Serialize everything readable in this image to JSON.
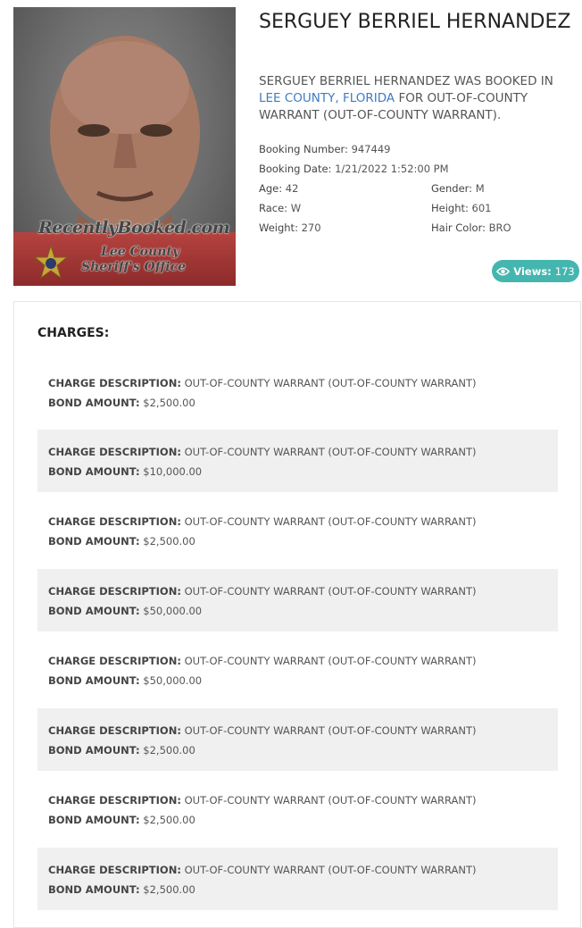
{
  "person": {
    "name": "SERGUEY BERRIEL HERNANDEZ",
    "summary_prefix": "SERGUEY BERRIEL HERNANDEZ WAS BOOKED IN",
    "location_link": "LEE COUNTY, FLORIDA",
    "summary_suffix": "FOR OUT-OF-COUNTY WARRANT (OUT-OF-COUNTY WARRANT)."
  },
  "photo": {
    "watermark_site": "RecentlyBooked.com",
    "watermark_county": "Lee County",
    "watermark_office": "Sheriff's Office"
  },
  "details": {
    "booking_number_label": "Booking Number:",
    "booking_number": "947449",
    "booking_date_label": "Booking Date:",
    "booking_date": "1/21/2022 1:52:00 PM",
    "age_label": "Age:",
    "age": "42",
    "gender_label": "Gender:",
    "gender": "M",
    "race_label": "Race:",
    "race": "W",
    "height_label": "Height:",
    "height": "601",
    "weight_label": "Weight:",
    "weight": "270",
    "hair_label": "Hair Color:",
    "hair": "BRO"
  },
  "views": {
    "label": "Views:",
    "count": "173"
  },
  "charges": {
    "heading": "CHARGES:",
    "desc_label": "CHARGE DESCRIPTION:",
    "bond_label": "BOND AMOUNT:",
    "items": [
      {
        "description": "OUT-OF-COUNTY WARRANT (OUT-OF-COUNTY WARRANT)",
        "bond": "$2,500.00"
      },
      {
        "description": "OUT-OF-COUNTY WARRANT (OUT-OF-COUNTY WARRANT)",
        "bond": "$10,000.00"
      },
      {
        "description": "OUT-OF-COUNTY WARRANT (OUT-OF-COUNTY WARRANT)",
        "bond": "$2,500.00"
      },
      {
        "description": "OUT-OF-COUNTY WARRANT (OUT-OF-COUNTY WARRANT)",
        "bond": "$50,000.00"
      },
      {
        "description": "OUT-OF-COUNTY WARRANT (OUT-OF-COUNTY WARRANT)",
        "bond": "$50,000.00"
      },
      {
        "description": "OUT-OF-COUNTY WARRANT (OUT-OF-COUNTY WARRANT)",
        "bond": "$2,500.00"
      },
      {
        "description": "OUT-OF-COUNTY WARRANT (OUT-OF-COUNTY WARRANT)",
        "bond": "$2,500.00"
      },
      {
        "description": "OUT-OF-COUNTY WARRANT (OUT-OF-COUNTY WARRANT)",
        "bond": "$2,500.00"
      }
    ]
  },
  "colors": {
    "accent": "#45b6af",
    "link": "#3d7cc2",
    "row_shade": "#f0f0f0"
  }
}
